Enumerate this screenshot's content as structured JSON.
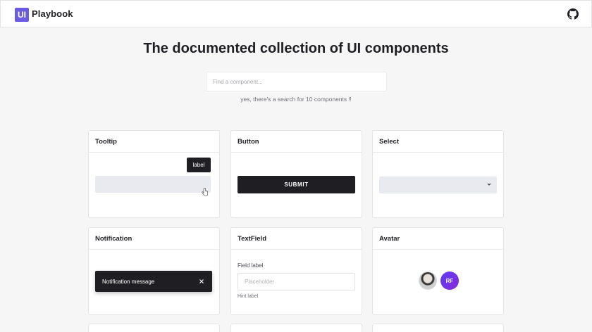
{
  "header": {
    "logo_mark": "UI",
    "logo_text": "Playbook",
    "github_icon": "github-icon"
  },
  "main": {
    "title": "The documented collection of UI components",
    "search": {
      "placeholder": "Find a component..."
    },
    "subtitle": "yes, there's a search for 10 components ‼"
  },
  "cards": {
    "tooltip": {
      "title": "Tooltip",
      "label": "label"
    },
    "button": {
      "title": "Button",
      "label": "SUBMIT"
    },
    "select": {
      "title": "Select",
      "icon": "chevron-down-icon"
    },
    "notification": {
      "title": "Notification",
      "message": "Notification message",
      "close_icon": "close-icon"
    },
    "textfield": {
      "title": "TextField",
      "label": "Field label",
      "placeholder": "Placeholder",
      "hint": "Hint label"
    },
    "avatar": {
      "title": "Avatar",
      "initials": "RF"
    }
  },
  "colors": {
    "brand": "#6b5bdf",
    "dark": "#1f1f23",
    "background": "#f6f6f6",
    "avatar_gradient_start": "#5b3df5",
    "avatar_gradient_end": "#8a2ad6"
  }
}
